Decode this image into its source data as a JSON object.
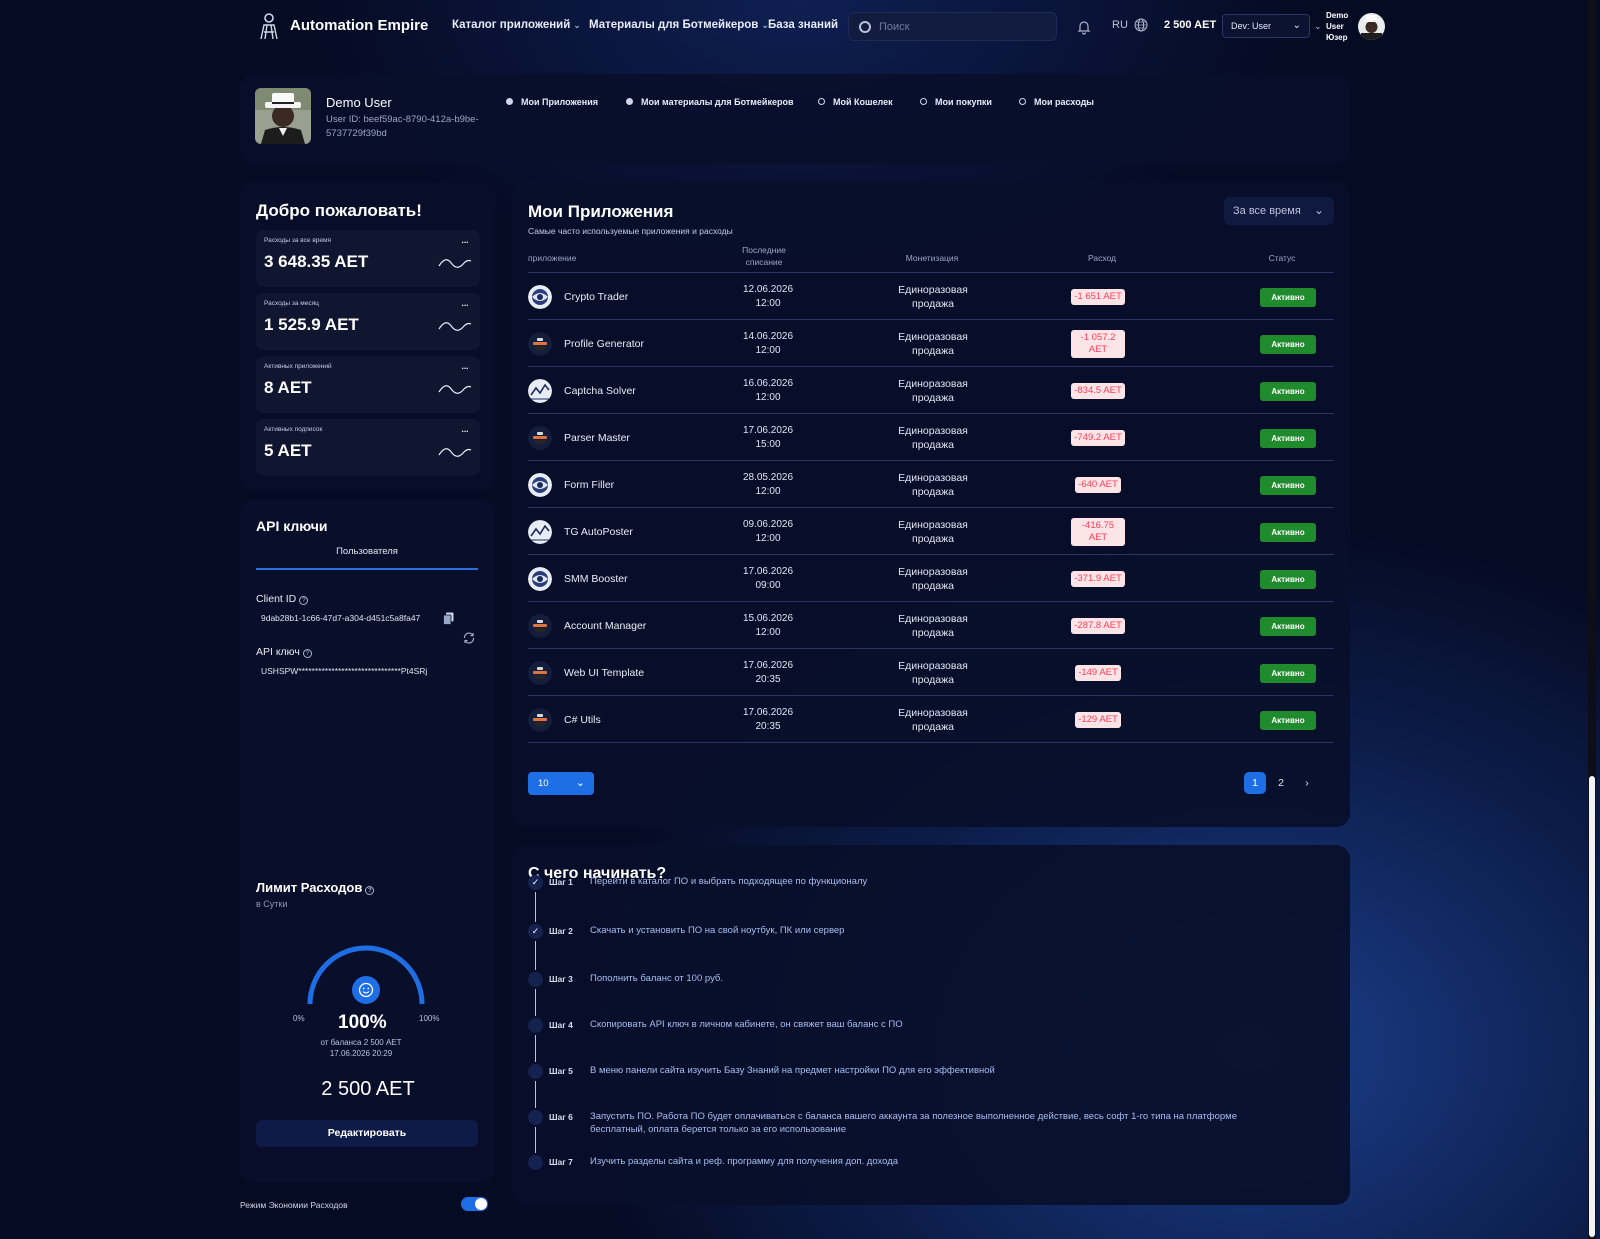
{
  "header": {
    "app_title": "Automation Empire",
    "nav": [
      {
        "label": "Каталог приложений"
      },
      {
        "label": "Материалы для Ботмейкеров"
      },
      {
        "label": "База знаний"
      }
    ],
    "search_placeholder": "Поиск",
    "language": "RU",
    "balance": "2 500 AET",
    "role_select": "Dev: User",
    "user_name": "Demo User Юзер"
  },
  "profile": {
    "name": "Demo User",
    "user_id": "User ID: beef59ac-8790-412a-b9be-5737729f39bd",
    "tabs": [
      {
        "label": "Мои Приложения"
      },
      {
        "label": "Мои материалы для Ботмейкеров"
      },
      {
        "label": "Мой Кошелек"
      },
      {
        "label": "Мои покупки"
      },
      {
        "label": "Мои расходы"
      }
    ]
  },
  "welcome": {
    "title": "Добро пожаловать!",
    "stats": [
      {
        "label": "Расходы за все время",
        "value": "3 648.35 AET"
      },
      {
        "label": "Расходы за месяц",
        "value": "1 525.9 AET"
      },
      {
        "label": "Активных приложений",
        "value": "8 AET"
      },
      {
        "label": "Активных подписок",
        "value": "5 AET"
      }
    ]
  },
  "api": {
    "title": "API ключи",
    "tab": "Пользователя",
    "client_id_label": "Client ID",
    "client_id": "9dab28b1-1c66-47d7-a304-d451c5a8fa47",
    "api_key_label": "API ключ",
    "api_key": "USHSPW*******************************Pt4SRj"
  },
  "limit": {
    "title": "Лимит Расходов",
    "subtitle": "в Сутки",
    "min": "0%",
    "max": "100%",
    "percent": "100%",
    "level": 1.0,
    "note": "от баланса 2 500 AET",
    "date": "17.06.2026 20:29",
    "amount": "2 500 AET",
    "edit_label": "Редактировать",
    "economy_mode_label": "Режим Экономии Расходов",
    "economy_mode_on": true
  },
  "apps": {
    "title": "Мои Приложения",
    "subtitle": "Самые часто используемые приложения и расходы",
    "period": "За все время",
    "columns": [
      "приложение",
      "Последние списание",
      "Монетизация",
      "Расход",
      "Статус"
    ],
    "rows": [
      {
        "name": "Crypto Trader",
        "date": "12.06.2026",
        "time": "12:00",
        "monetization": "Единоразовая продажа",
        "cost": "-1 651 AET",
        "status": "Активно",
        "icon": "globe-logo-icon"
      },
      {
        "name": "Profile Generator",
        "date": "14.06.2026",
        "time": "12:00",
        "monetization": "Единоразовая продажа",
        "cost": "-1 057.2 AET",
        "status": "Активно",
        "icon": "bot-logo-icon"
      },
      {
        "name": "Captcha Solver",
        "date": "16.06.2026",
        "time": "12:00",
        "monetization": "Единоразовая продажа",
        "cost": "-834.5 AET",
        "status": "Активно",
        "icon": "chart-logo-icon"
      },
      {
        "name": "Parser Master",
        "date": "17.06.2026",
        "time": "15:00",
        "monetization": "Единоразовая продажа",
        "cost": "-749.2 AET",
        "status": "Активно",
        "icon": "bot-logo-icon"
      },
      {
        "name": "Form Filler",
        "date": "28.05.2026",
        "time": "12:00",
        "monetization": "Единоразовая продажа",
        "cost": "-640 AET",
        "status": "Активно",
        "icon": "globe-logo-icon"
      },
      {
        "name": "TG AutoPoster",
        "date": "09.06.2026",
        "time": "12:00",
        "monetization": "Единоразовая продажа",
        "cost": "-416.75 AET",
        "status": "Активно",
        "icon": "chart-logo-icon"
      },
      {
        "name": "SMM Booster",
        "date": "17.06.2026",
        "time": "09:00",
        "monetization": "Единоразовая продажа",
        "cost": "-371.9 AET",
        "status": "Активно",
        "icon": "globe-logo-icon"
      },
      {
        "name": "Account Manager",
        "date": "15.06.2026",
        "time": "12:00",
        "monetization": "Единоразовая продажа",
        "cost": "-287.8 AET",
        "status": "Активно",
        "icon": "bot-logo-icon"
      },
      {
        "name": "Web UI Template",
        "date": "17.06.2026",
        "time": "20:35",
        "monetization": "Единоразовая продажа",
        "cost": "-149 AET",
        "status": "Активно",
        "icon": "bot-logo-icon"
      },
      {
        "name": "C# Utils",
        "date": "17.06.2026",
        "time": "20:35",
        "monetization": "Единоразовая продажа",
        "cost": "-129 AET",
        "status": "Активно",
        "icon": "bot-logo-icon"
      }
    ],
    "page_size": "10",
    "pages": [
      "1",
      "2"
    ],
    "current_page": "1"
  },
  "steps": {
    "title": "С чего начинать?",
    "items": [
      {
        "label": "Шаг 1",
        "text": "Перейти в каталог ПО и выбрать подходящее по функционалу",
        "done": true
      },
      {
        "label": "Шаг 2",
        "text": "Скачать и установить ПО на свой ноутбук, ПК или сервер",
        "done": true
      },
      {
        "label": "Шаг 3",
        "text": "Пополнить баланс от 100 руб.",
        "done": false
      },
      {
        "label": "Шаг 4",
        "text": "Скопировать API ключ в личном кабинете, он свяжет ваш баланс с ПО",
        "done": false
      },
      {
        "label": "Шаг 5",
        "text": "В меню панели сайта изучить Базу Знаний на предмет настройки ПО для его эффективной",
        "done": false
      },
      {
        "label": "Шаг 6",
        "text": "Запустить ПО. Работа ПО будет оплачиваться с баланса вашего аккаунта за полезное выполненное действие, весь софт 1-го типа на платформе бесплатный, оплата берется только за его использование",
        "done": false
      },
      {
        "label": "Шаг 7",
        "text": "Изучить разделы сайта и реф. программу для получения доп. дохода",
        "done": false
      }
    ]
  },
  "colors": {
    "background": "#060b24",
    "panel": "#090f2a",
    "accent": "#1e6ee6",
    "status_active": "#1f8b2c",
    "cost_text": "#ff3d5a",
    "cost_bg": "#fde5e7"
  }
}
